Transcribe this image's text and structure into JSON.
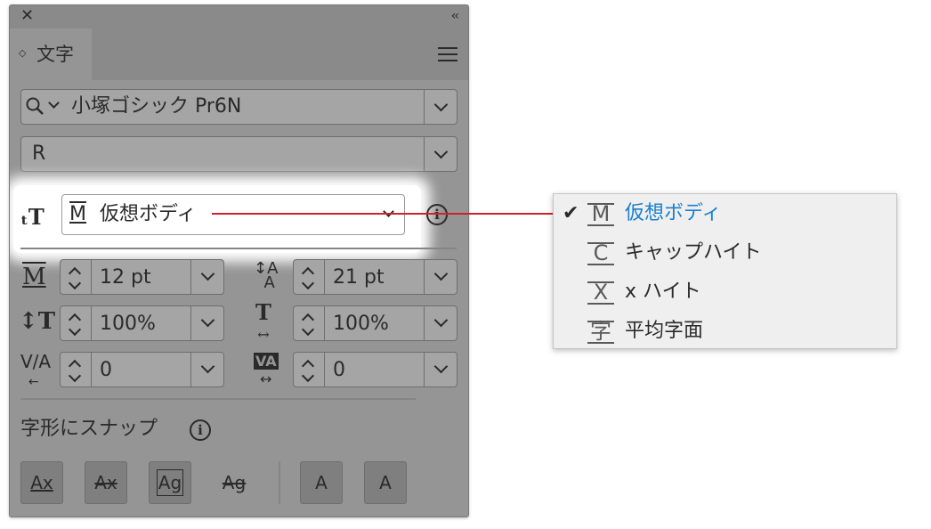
{
  "panel": {
    "tab_label": "文字",
    "font_family": "小塚ゴシック Pr6N",
    "font_style": "R",
    "reference": {
      "selected_label": "仮想ボディ",
      "icon_letter": "M"
    },
    "size_value": "12 pt",
    "leading_value": "21 pt",
    "vscale_value": "100%",
    "hscale_value": "100%",
    "kerning_value": "0",
    "tracking_value": "0",
    "snap_label": "字形にスナップ",
    "snap_buttons": [
      "Ax",
      "Ax",
      "Ag",
      "Ag",
      "A",
      "A"
    ]
  },
  "popup": {
    "items": [
      {
        "icon": "M",
        "label": "仮想ボディ",
        "selected": true
      },
      {
        "icon": "C",
        "label": "キャップハイト",
        "selected": false
      },
      {
        "icon": "X",
        "label": "x ハイト",
        "selected": false
      },
      {
        "icon": "字",
        "label": "平均字面",
        "selected": false
      }
    ],
    "check_mark": "✔"
  },
  "colors": {
    "panel_bg": "#959595",
    "selected_text": "#1a7fd1",
    "connector": "#d0222c"
  },
  "icons": [
    "close-icon",
    "collapse-icon",
    "panel-menu-icon",
    "search-icon",
    "chevron-down-icon",
    "info-icon",
    "spinner-icon"
  ]
}
